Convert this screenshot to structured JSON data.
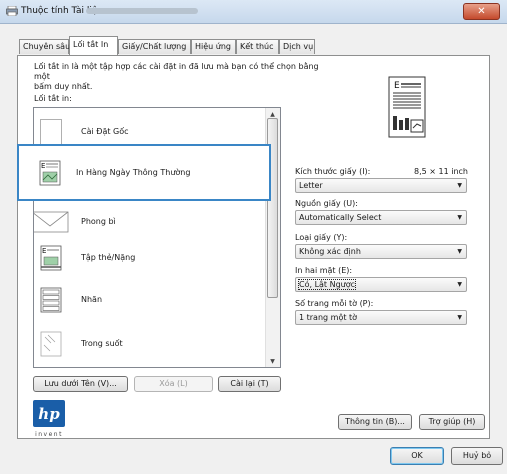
{
  "window": {
    "title": "Thuộc tính Tài liệu",
    "close_label": "✕"
  },
  "tabs": [
    {
      "label": "Chuyên sâu"
    },
    {
      "label": "Lối tắt In"
    },
    {
      "label": "Giấy/Chất lượng"
    },
    {
      "label": "Hiệu ứng"
    },
    {
      "label": "Kết thúc"
    },
    {
      "label": "Dịch vụ"
    }
  ],
  "shortcuts": {
    "description_line1": "Lối tắt in là một tập hợp các cài đặt in đã lưu mà bạn có thể chọn bằng một",
    "description_line2": "bấm duy nhất.",
    "list_label": "Lối tắt in:",
    "items": [
      {
        "label": "Cài Đặt Gốc",
        "icon": "blank-page-icon"
      },
      {
        "label": "In Hàng Ngày Thông Thường",
        "icon": "photo-document-icon",
        "selected": true
      },
      {
        "label": "Phong bì",
        "icon": "envelope-icon"
      },
      {
        "label": "Tập thẻ/Nặng",
        "icon": "cardstock-icon"
      },
      {
        "label": "Nhãn",
        "icon": "labels-icon"
      },
      {
        "label": "Trong suốt",
        "icon": "transparency-icon"
      }
    ]
  },
  "settings": {
    "paper_size": {
      "label": "Kích thước giấy (I):",
      "value": "Letter",
      "dimension": "8,5 × 11 inch"
    },
    "paper_source": {
      "label": "Nguồn giấy (U):",
      "value": "Automatically Select"
    },
    "paper_type": {
      "label": "Loại giấy (Y):",
      "value": "Không xác định"
    },
    "duplex": {
      "label": "In hai mặt (E):",
      "value": "Có, Lật Ngược"
    },
    "pages_per_sheet": {
      "label": "Số trang mỗi tờ (P):",
      "value": "1 trang một tờ"
    }
  },
  "shortcut_buttons": {
    "save_as": "Lưu dưới Tên (V)...",
    "delete": "Xóa (L)",
    "reset": "Cài lại (T)"
  },
  "footer": {
    "info": "Thông tin (B)...",
    "help": "Trợ giúp (H)",
    "ok": "OK",
    "cancel": "Huỷ bỏ",
    "logo_text": "invent"
  }
}
